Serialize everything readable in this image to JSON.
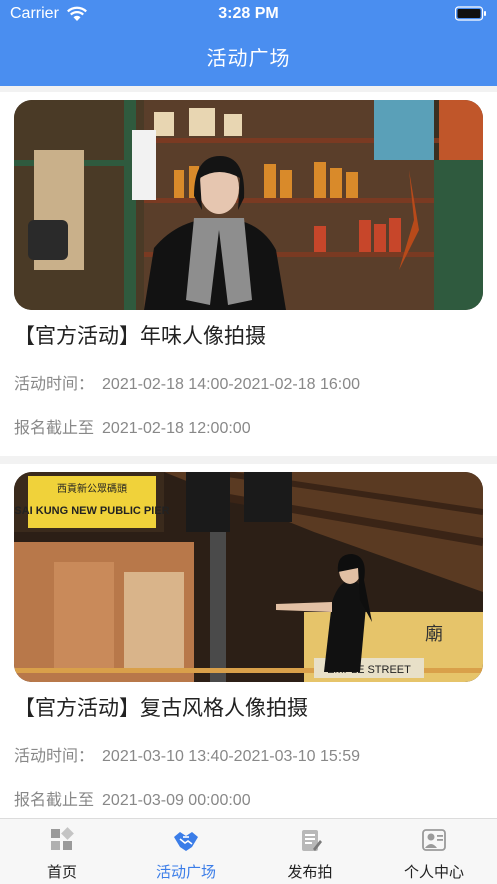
{
  "status_bar": {
    "carrier": "Carrier",
    "time": "3:28 PM"
  },
  "header": {
    "title": "活动广场"
  },
  "activities": [
    {
      "title": "【官方活动】年味人像拍摄",
      "time_label": "活动时间：",
      "time_value": "2021-02-18 14:00-2021-02-18 16:00",
      "deadline_label": "报名截止至",
      "deadline_value": "2021-02-18 12:00:00"
    },
    {
      "title": "【官方活动】复古风格人像拍摄",
      "time_label": "活动时间：",
      "time_value": "2021-03-10 13:40-2021-03-10 15:59",
      "deadline_label": "报名截止至",
      "deadline_value": "2021-03-09 00:00:00",
      "photo_signs": [
        "西貢新公眾碼頭",
        "SAI KUNG NEW PUBLIC PIER",
        "EMPLE STREET",
        "廟"
      ]
    }
  ],
  "tabbar": {
    "items": [
      {
        "label": "首页",
        "icon": "home-grid-icon",
        "active": false
      },
      {
        "label": "活动广场",
        "icon": "handshake-icon",
        "active": true
      },
      {
        "label": "发布拍",
        "icon": "publish-icon",
        "active": false
      },
      {
        "label": "个人中心",
        "icon": "profile-icon",
        "active": false
      }
    ]
  },
  "colors": {
    "accent": "#4a8ef0",
    "active_tab": "#3b7de8",
    "meta_text": "#888888"
  }
}
